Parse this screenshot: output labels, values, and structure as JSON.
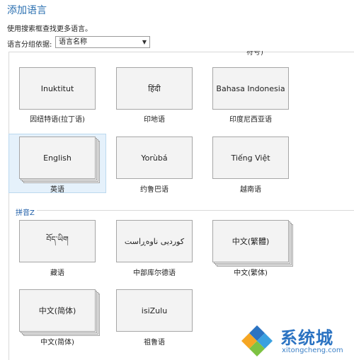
{
  "header": {
    "title": "添加语言",
    "subtitle": "使用搜索框查找更多语言。"
  },
  "group_by": {
    "label": "语言分组依据:",
    "selected": "语言名称"
  },
  "partial_label": "符号)",
  "groups": [
    {
      "header": "",
      "languages": [
        {
          "tile": "Inuktitut",
          "caption": "因纽特语(拉丁语)",
          "stacked": false,
          "selected": false
        },
        {
          "tile": "हिंदी",
          "caption": "印地语",
          "stacked": false,
          "selected": false
        },
        {
          "tile": "Bahasa Indonesia",
          "caption": "印度尼西亚语",
          "stacked": false,
          "selected": false
        },
        {
          "tile": "English",
          "caption": "英语",
          "stacked": true,
          "selected": true
        },
        {
          "tile": "Yorùbá",
          "caption": "约鲁巴语",
          "stacked": false,
          "selected": false
        },
        {
          "tile": "Tiếng Việt",
          "caption": "越南语",
          "stacked": false,
          "selected": false
        }
      ]
    },
    {
      "header": "拼音Z",
      "languages": [
        {
          "tile": "བོད་ཡིག",
          "caption": "藏语",
          "stacked": false,
          "selected": false
        },
        {
          "tile": "كوردیی ناوەڕاست",
          "caption": "中部库尔德语",
          "stacked": false,
          "selected": false
        },
        {
          "tile": "中文(繁體)",
          "caption": "中文(繁体)",
          "stacked": true,
          "selected": false
        },
        {
          "tile": "中文(简体)",
          "caption": "中文(简体)",
          "stacked": true,
          "selected": false
        },
        {
          "tile": "isiZulu",
          "caption": "祖鲁语",
          "stacked": false,
          "selected": false
        }
      ]
    }
  ],
  "watermark": {
    "text": "系统城",
    "url": "xitongcheng.com",
    "colors": [
      "#2b73c2",
      "#3aa0e0",
      "#7dc242",
      "#f5a623"
    ]
  },
  "icons": {
    "dropdown": "chevron-down-icon",
    "logo": "diamond-logo-icon"
  }
}
